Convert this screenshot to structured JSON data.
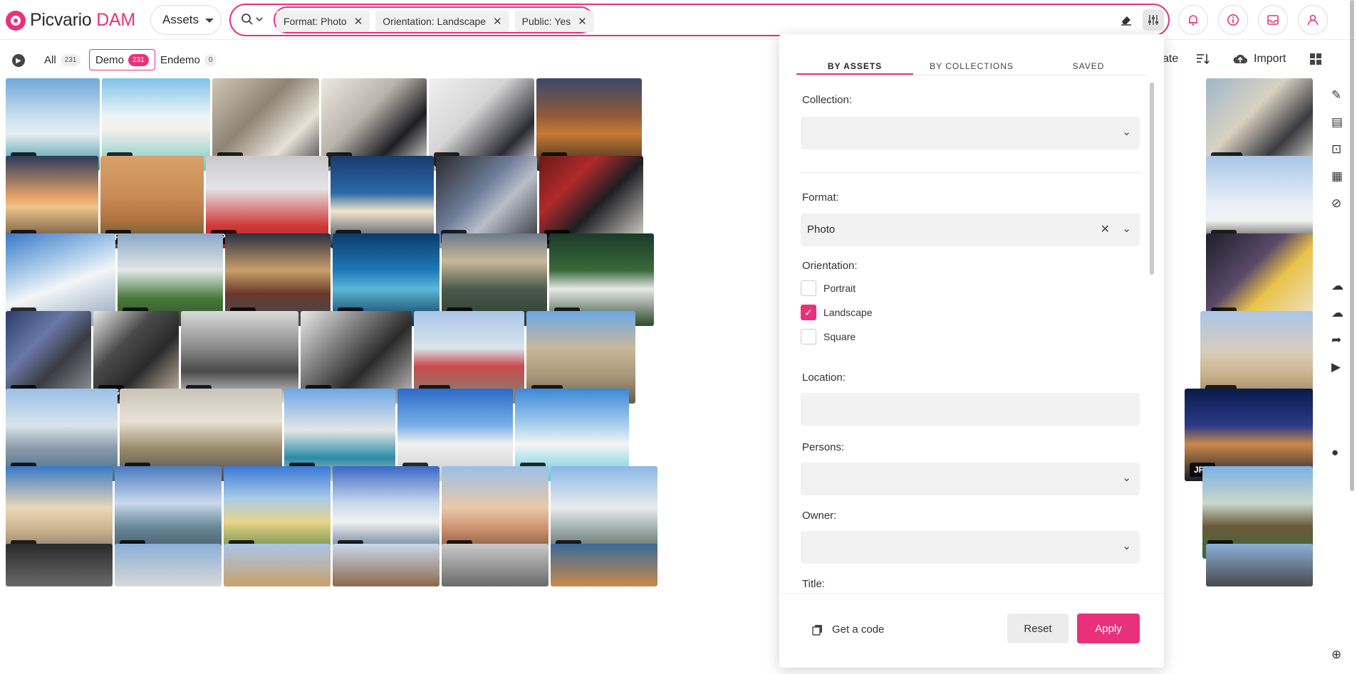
{
  "app": {
    "brand_main": "Picvario",
    "brand_accent": "DAM",
    "accent_color": "#e9317b"
  },
  "header": {
    "scope_select": "Assets",
    "chips": [
      {
        "label": "Format: Photo"
      },
      {
        "label": "Orientation: Landscape"
      },
      {
        "label": "Public: Yes"
      }
    ],
    "icons": [
      "search-icon",
      "eraser-icon",
      "filter-settings-icon",
      "bell-icon",
      "info-icon",
      "inbox-icon",
      "user-icon"
    ]
  },
  "tabs": [
    {
      "label": "All",
      "count": "231"
    },
    {
      "label": "Demo",
      "count": "231",
      "active": true
    },
    {
      "label": "Endemo",
      "count": "0"
    }
  ],
  "toolbar": {
    "partial_label": "ate",
    "import_label": "Import"
  },
  "panel": {
    "tabs": [
      "BY ASSETS",
      "BY COLLECTIONS",
      "SAVED"
    ],
    "collection_label": "Collection:",
    "format_label": "Format:",
    "format_value": "Photo",
    "orientation_label": "Orientation:",
    "orientations": [
      {
        "label": "Portrait",
        "checked": false
      },
      {
        "label": "Landscape",
        "checked": true
      },
      {
        "label": "Square",
        "checked": false
      }
    ],
    "location_label": "Location:",
    "persons_label": "Persons:",
    "owner_label": "Owner:",
    "title_label": "Title:",
    "get_code_label": "Get a code",
    "reset_label": "Reset",
    "apply_label": "Apply"
  },
  "grid": {
    "rows": [
      {
        "items": [
          {
            "badge": "JPG",
            "bg": "linear-gradient(180deg,#6fa8d8 0%,#cfe3f2 45%,#e6eef2 60%,#2d8fa0 100%)"
          },
          {
            "badge": "JPG",
            "bg": "linear-gradient(180deg,#7ec3e8 0%,#eaf4f7 40%,#f4f1ea 55%,#6fc7c2 100%)"
          },
          {
            "badge": "JPG",
            "bg": "linear-gradient(135deg,#cfc6b6 0%,#8e8474 40%,#e7e1d6 70%,#3b3b44 100%)"
          },
          {
            "badge": "JPG",
            "bg": "linear-gradient(135deg,#ece9e2 0%,#b9b4aa 40%,#1e1e22 70%,#f2f2f2 100%)"
          },
          {
            "badge": "JPG",
            "bg": "linear-gradient(135deg,#f1f1f1 0%,#d5d5d5 40%,#2a2a33 75%,#ededed 100%)"
          },
          {
            "badge": "JPG",
            "bg": "linear-gradient(180deg,#3b4a6a 0%,#8e5a3a 40%,#c77b34 60%,#2b2420 100%)"
          },
          {
            "badge": "JPEG",
            "bg": "linear-gradient(135deg,#9eb7c9 0%,#d9d2c2 40%,#3a3a40 70%,#e8e4dc 100%)"
          }
        ]
      },
      {
        "items": [
          {
            "badge": "JPG",
            "bg": "linear-gradient(180deg,#2c3c5a 0%,#e8a36a 45%,#f0c58a 55%,#4a3a30 100%)"
          },
          {
            "badge": "JPG",
            "bg": "linear-gradient(180deg,#d9a06a 0%,#c98b55 45%,#b07040 70%,#3c5a32 100%)"
          },
          {
            "badge": "JPG",
            "bg": "linear-gradient(180deg,#c9c9cc 0%,#e4e4e6 35%,#d23a3a 75%,#b02020 100%)"
          },
          {
            "badge": "JPG",
            "bg": "linear-gradient(180deg,#1a3a6a 0%,#2a6aa8 40%,#f1e6c9 60%,#1a2a4a 100%)"
          },
          {
            "badge": "JPG",
            "bg": "linear-gradient(135deg,#2a2a2a 0%,#6c7a96 40%,#b9bec9 60%,#2a2a30 100%)"
          },
          {
            "badge": "JPG",
            "bg": "linear-gradient(135deg,#6a1a1a 0%,#b02a2a 30%,#1e1e22 55%,#e9e6dd 100%)"
          },
          {
            "badge": "JPG",
            "bg": "linear-gradient(180deg,#a9c6e8 0%,#e6eef6 50%,#f3f3f3 70%,#1a1a1a 100%)"
          }
        ]
      },
      {
        "items": [
          {
            "badge": "JPG",
            "bg": "linear-gradient(160deg,#3a78c8 0%,#a9cbe8 35%,#f3f6f9 55%,#8aa2b8 100%)"
          },
          {
            "badge": "JPG",
            "bg": "linear-gradient(180deg,#8aa8c8 0%,#e2e6e8 40%,#4a7a3a 70%,#2a4a2a 100%)"
          },
          {
            "badge": "JPG",
            "bg": "linear-gradient(180deg,#2a3040 0%,#c9a06a 40%,#6a3a2a 65%,#3a4a5a 100%)"
          },
          {
            "badge": "JPG",
            "bg": "linear-gradient(180deg,#0a3a6a 0%,#1e7ab8 40%,#5ab8d8 60%,#0a2a4a 100%)"
          },
          {
            "badge": "JPG",
            "bg": "linear-gradient(180deg,#6a7a8a 0%,#c9b89a 30%,#4a5a4a 60%,#2a3a30 100%)"
          },
          {
            "badge": "JPG",
            "bg": "linear-gradient(180deg,#1a3a2a 0%,#3a6a3a 40%,#e8e8e8 60%,#2a4a2a 100%)"
          },
          {
            "badge": "JPG",
            "bg": "linear-gradient(135deg,#1e1e2a 0%,#5a4a6a 40%,#e9c44a 60%,#f1e4d6 100%)"
          }
        ]
      },
      {
        "items": [
          {
            "badge": "JPG",
            "bg": "linear-gradient(135deg,#2a3a6a 0%,#6a7aa8 35%,#3a3a40 60%,#9aa0a8 100%)"
          },
          {
            "badge": "JPG",
            "bg": "linear-gradient(135deg,#e9e9e9 0%,#4a4a4a 35%,#2a2a2a 60%,#d9c9b9 100%)"
          },
          {
            "badge": "JPG",
            "bg": "linear-gradient(180deg,#d9d9d9 0%,#8a8a8a 40%,#4a4a4a 65%,#e6e6e6 100%)"
          },
          {
            "badge": "JPG",
            "bg": "linear-gradient(135deg,#eaeaea 0%,#6a6a6a 40%,#2a2a2a 60%,#c9c9c9 100%)"
          },
          {
            "badge": "JPEG",
            "bg": "linear-gradient(180deg,#a9c6e8 0%,#d9e4ec 40%,#c94a4a 60%,#7a8a7a 100%)"
          },
          {
            "badge": "JPEG",
            "bg": "linear-gradient(180deg,#6aa8e8 0%,#c9b89a 40%,#a8987a 70%,#6a5a4a 100%)"
          },
          {
            "badge": "JPEG",
            "bg": "linear-gradient(180deg,#a9c6e8 0%,#d9cdb9 45%,#c9b08a 70%,#8a7a5a 100%)"
          }
        ]
      },
      {
        "items": [
          {
            "badge": "JPG",
            "bg": "linear-gradient(180deg,#9ac0e6 0%,#d9e4ec 40%,#8a98a8 65%,#3a6a8a 100%)"
          },
          {
            "badge": "JPG",
            "bg": "linear-gradient(180deg,#c9c4b8 0%,#e9e2d6 35%,#9a8a6a 65%,#4a4a50 100%)"
          },
          {
            "badge": "JPG",
            "bg": "linear-gradient(180deg,#6aa8e8 0%,#e6e6e6 45%,#2a8aa8 75%,#d9c9a9 100%)"
          },
          {
            "badge": "JPG",
            "bg": "linear-gradient(180deg,#2a6ac8 0%,#7ab0e8 40%,#f1f1f1 60%,#c9c9c9 100%)"
          },
          {
            "badge": "JPG",
            "bg": "linear-gradient(180deg,#3a88d8 0%,#a9d0ee 40%,#f4f4f4 60%,#5ac8d8 100%)"
          },
          {
            "badge": "JPG",
            "bg": "linear-gradient(180deg,#0a1a4a 0%,#2a3a8a 40%,#c98a4a 60%,#1a1a2a 100%)"
          }
        ]
      },
      {
        "items": [
          {
            "badge": "JPG",
            "bg": "linear-gradient(180deg,#3a78c8 0%,#e9d9b9 45%,#c9b089 70%,#6a6a6a 100%)"
          },
          {
            "badge": "JPG",
            "bg": "linear-gradient(180deg,#4a7ac0 0%,#c9d9ec 40%,#6a8a9a 65%,#3a4a5a 100%)"
          },
          {
            "badge": "JPG",
            "bg": "linear-gradient(180deg,#3a78d8 0%,#a9cbe8 35%,#e9d48a 60%,#4a7a3a 100%)"
          },
          {
            "badge": "JPG",
            "bg": "linear-gradient(180deg,#3a68c8 0%,#c9d9ec 40%,#f1f1f1 60%,#3a5a7a 100%)"
          },
          {
            "badge": "JPG",
            "bg": "linear-gradient(180deg,#9ac0e6 0%,#e9c9a9 45%,#c98a6a 70%,#5a4a3a 100%)"
          },
          {
            "badge": "JPG",
            "bg": "linear-gradient(180deg,#8ab8e6 0%,#e9ecee 45%,#9aa8a8 70%,#4a5a4a 100%)"
          },
          {
            "badge": "JPG",
            "bg": "linear-gradient(180deg,#7ab0e6 0%,#c9d9c9 40%,#6a5a3a 65%,#3a6a3a 100%)"
          }
        ]
      },
      {
        "items": [
          {
            "badge": "",
            "bg": "linear-gradient(180deg,#2a2a2a 0%,#6a6a6a 100%)"
          },
          {
            "badge": "",
            "bg": "linear-gradient(180deg,#8ab0d8 0%,#d9d9d9 100%)"
          },
          {
            "badge": "",
            "bg": "linear-gradient(180deg,#a9c6e8 0%,#c9a06a 100%)"
          },
          {
            "badge": "",
            "bg": "linear-gradient(180deg,#c9d9ec 0%,#8a6a4a 100%)"
          },
          {
            "badge": "",
            "bg": "linear-gradient(180deg,#c9c9c9 0%,#6a6a6a 100%)"
          },
          {
            "badge": "",
            "bg": "linear-gradient(180deg,#3a6a9a 0%,#c98a4a 100%)"
          },
          {
            "badge": "",
            "bg": "linear-gradient(180deg,#8ab0d8 0%,#4a4a4a 100%)"
          }
        ]
      }
    ]
  }
}
